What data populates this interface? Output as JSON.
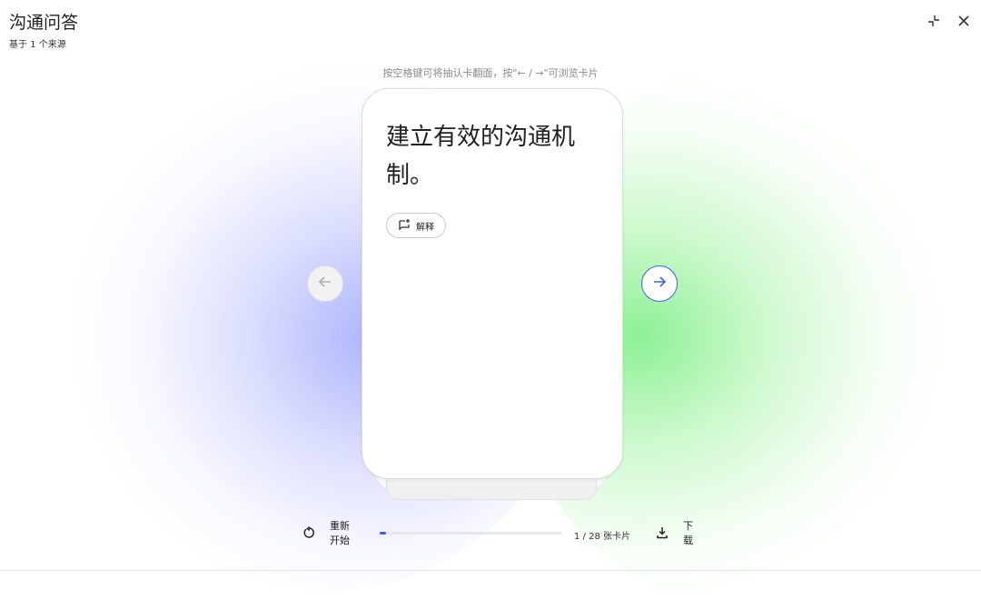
{
  "header": {
    "title": "沟通问答",
    "subtitle": "基于 1 个来源",
    "collapse_icon": "collapse-icon",
    "close_icon": "close-icon"
  },
  "hint": "按空格键可将抽认卡翻面，按\"← / →\"可浏览卡片",
  "card": {
    "text": "建立有效的沟通机制。",
    "explain_label": "解释",
    "explain_icon": "explain-sparkle-icon"
  },
  "nav": {
    "prev_icon": "arrow-left-icon",
    "next_icon": "arrow-right-icon"
  },
  "footer": {
    "restart_label": "重新开始",
    "restart_icon": "restart-icon",
    "counter": "1 / 28 张卡片",
    "progress_fraction": 0.036,
    "download_label": "下载",
    "download_icon": "download-icon"
  },
  "colors": {
    "accent": "#3d5ef0",
    "glow_left": "#aab3f8",
    "glow_right": "#8ff09a"
  }
}
